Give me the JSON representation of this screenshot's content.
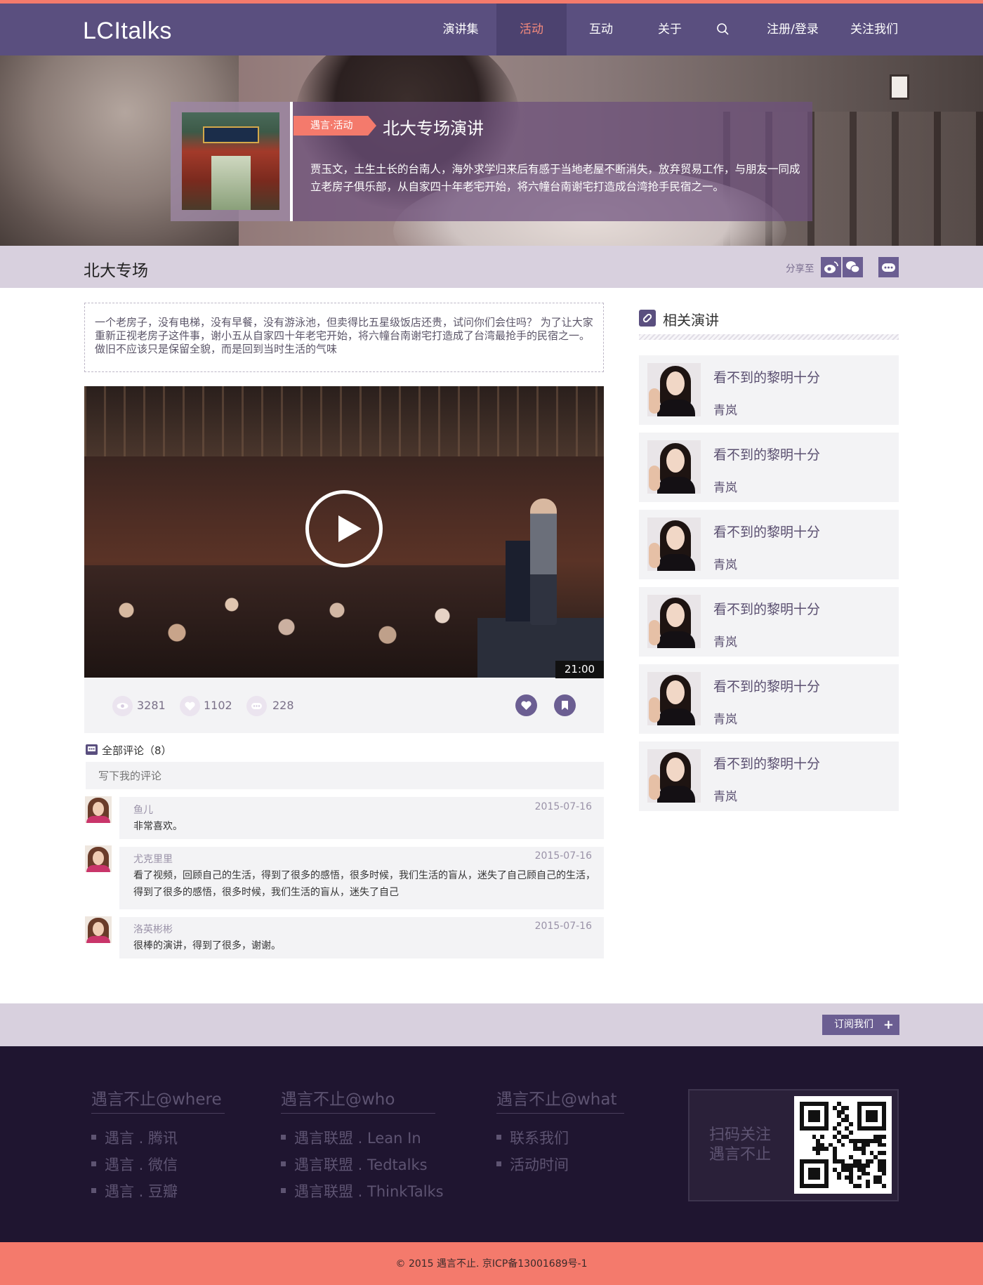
{
  "brand": {
    "logo_text": "LCItalks",
    "accent": "#f47a6c",
    "primary": "#5a4f7f"
  },
  "nav": {
    "items": [
      {
        "label": "演讲集",
        "active": false
      },
      {
        "label": "活动",
        "active": true
      },
      {
        "label": "互动",
        "active": false
      },
      {
        "label": "关于",
        "active": false
      }
    ],
    "search_icon": "search-icon",
    "login_label": "注册/登录",
    "follow_label": "关注我们"
  },
  "hero": {
    "tag": "遇言·活动",
    "title": "北大专场演讲",
    "description": "贾玉文，土生土长的台南人，海外求学归来后有感于当地老屋不断消失，放弃贸易工作，与朋友一同成立老房子俱乐部，从自家四十年老宅开始，将六幢台南谢宅打造成台湾抢手民宿之一。"
  },
  "page": {
    "title": "北大专场",
    "share_label": "分享至",
    "share_icons": [
      "weibo-icon",
      "wechat-icon",
      "more-icon"
    ]
  },
  "intro": "一个老房子，没有电梯，没有早餐，没有游泳池，但卖得比五星级饭店还贵，试问你们会住吗？ 为了让大家重新正视老房子这件事，谢小五从自家四十年老宅开始，将六幢台南谢宅打造成了台湾最抢手的民宿之一。 做旧不应该只是保留全貌，而是回到当时生活的气味",
  "video": {
    "duration": "21:00",
    "views": "3281",
    "likes": "1102",
    "comments": "228",
    "play_icon": "play-icon",
    "like_icon": "heart-icon",
    "bookmark_icon": "bookmark-icon"
  },
  "comments": {
    "header": "全部评论（8）",
    "placeholder": "写下我的评论",
    "items": [
      {
        "name": "鱼儿",
        "date": "2015-07-16",
        "text": "非常喜欢。"
      },
      {
        "name": "尤克里里",
        "date": "2015-07-16",
        "text": "看了视频，回顾自己的生活，得到了很多的感悟，很多时候，我们生活的盲从，迷失了自己顾自己的生活，得到了很多的感悟，很多时候，我们生活的盲从，迷失了自己"
      },
      {
        "name": "洛英彬彬",
        "date": "2015-07-16",
        "text": "很棒的演讲，得到了很多，谢谢。"
      }
    ]
  },
  "related": {
    "header": "相关演讲",
    "items": [
      {
        "title": "看不到的黎明十分",
        "author": "青岚"
      },
      {
        "title": "看不到的黎明十分",
        "author": "青岚"
      },
      {
        "title": "看不到的黎明十分",
        "author": "青岚"
      },
      {
        "title": "看不到的黎明十分",
        "author": "青岚"
      },
      {
        "title": "看不到的黎明十分",
        "author": "青岚"
      },
      {
        "title": "看不到的黎明十分",
        "author": "青岚"
      }
    ]
  },
  "subscribe": {
    "label": "订阅我们",
    "icon": "plus-icon"
  },
  "footer": {
    "columns": [
      {
        "title": "遇言不止@where",
        "items": [
          "遇言 . 腾讯",
          "遇言 . 微信",
          "遇言 . 豆瓣"
        ]
      },
      {
        "title": "遇言不止@who",
        "items": [
          "遇言联盟 . Lean In",
          "遇言联盟 . Tedtalks",
          "遇言联盟 . ThinkTalks"
        ]
      },
      {
        "title": "遇言不止@what",
        "items": [
          "联系我们",
          "活动时间"
        ]
      }
    ],
    "qr_text_line1": "扫码关注",
    "qr_text_line2": "遇言不止",
    "copyright": "© 2015 遇言不止. 京ICP备13001689号-1"
  }
}
